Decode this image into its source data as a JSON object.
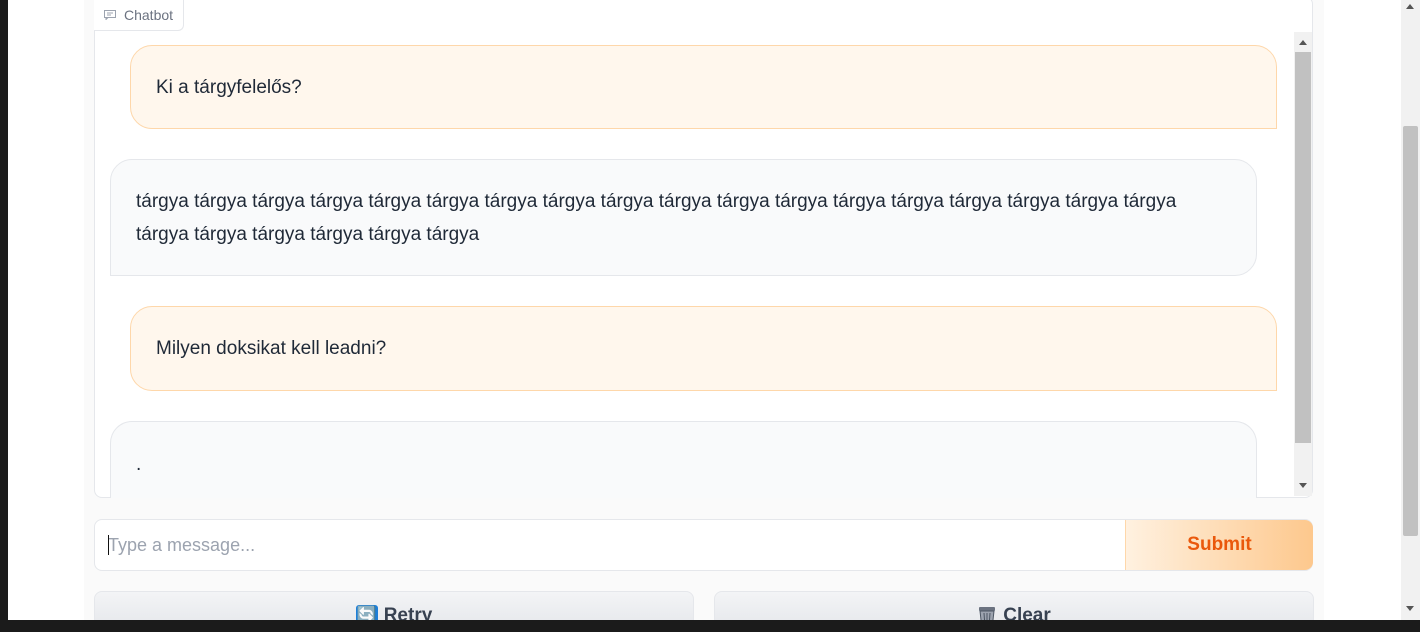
{
  "chatbot": {
    "label": "Chatbot",
    "messages": [
      {
        "role": "user",
        "text": "Ki a tárgyfelelős?"
      },
      {
        "role": "bot",
        "text": "tárgya tárgya tárgya tárgya tárgya tárgya tárgya tárgya tárgya tárgya tárgya tárgya tárgya tárgya tárgya tárgya tárgya tárgya tárgya tárgya tárgya tárgya tárgya tárgya"
      },
      {
        "role": "user",
        "text": "Milyen doksikat kell leadni?"
      },
      {
        "role": "bot",
        "text": "."
      }
    ]
  },
  "input": {
    "placeholder": "Type a message...",
    "value": ""
  },
  "buttons": {
    "submit_label": "Submit",
    "retry_label": "Retry",
    "retry_icon": "🔄",
    "clear_label": "Clear"
  },
  "colors": {
    "accent": "#ea580c",
    "user_bubble": "#fff7ed",
    "bot_bubble": "#f9fafb"
  }
}
